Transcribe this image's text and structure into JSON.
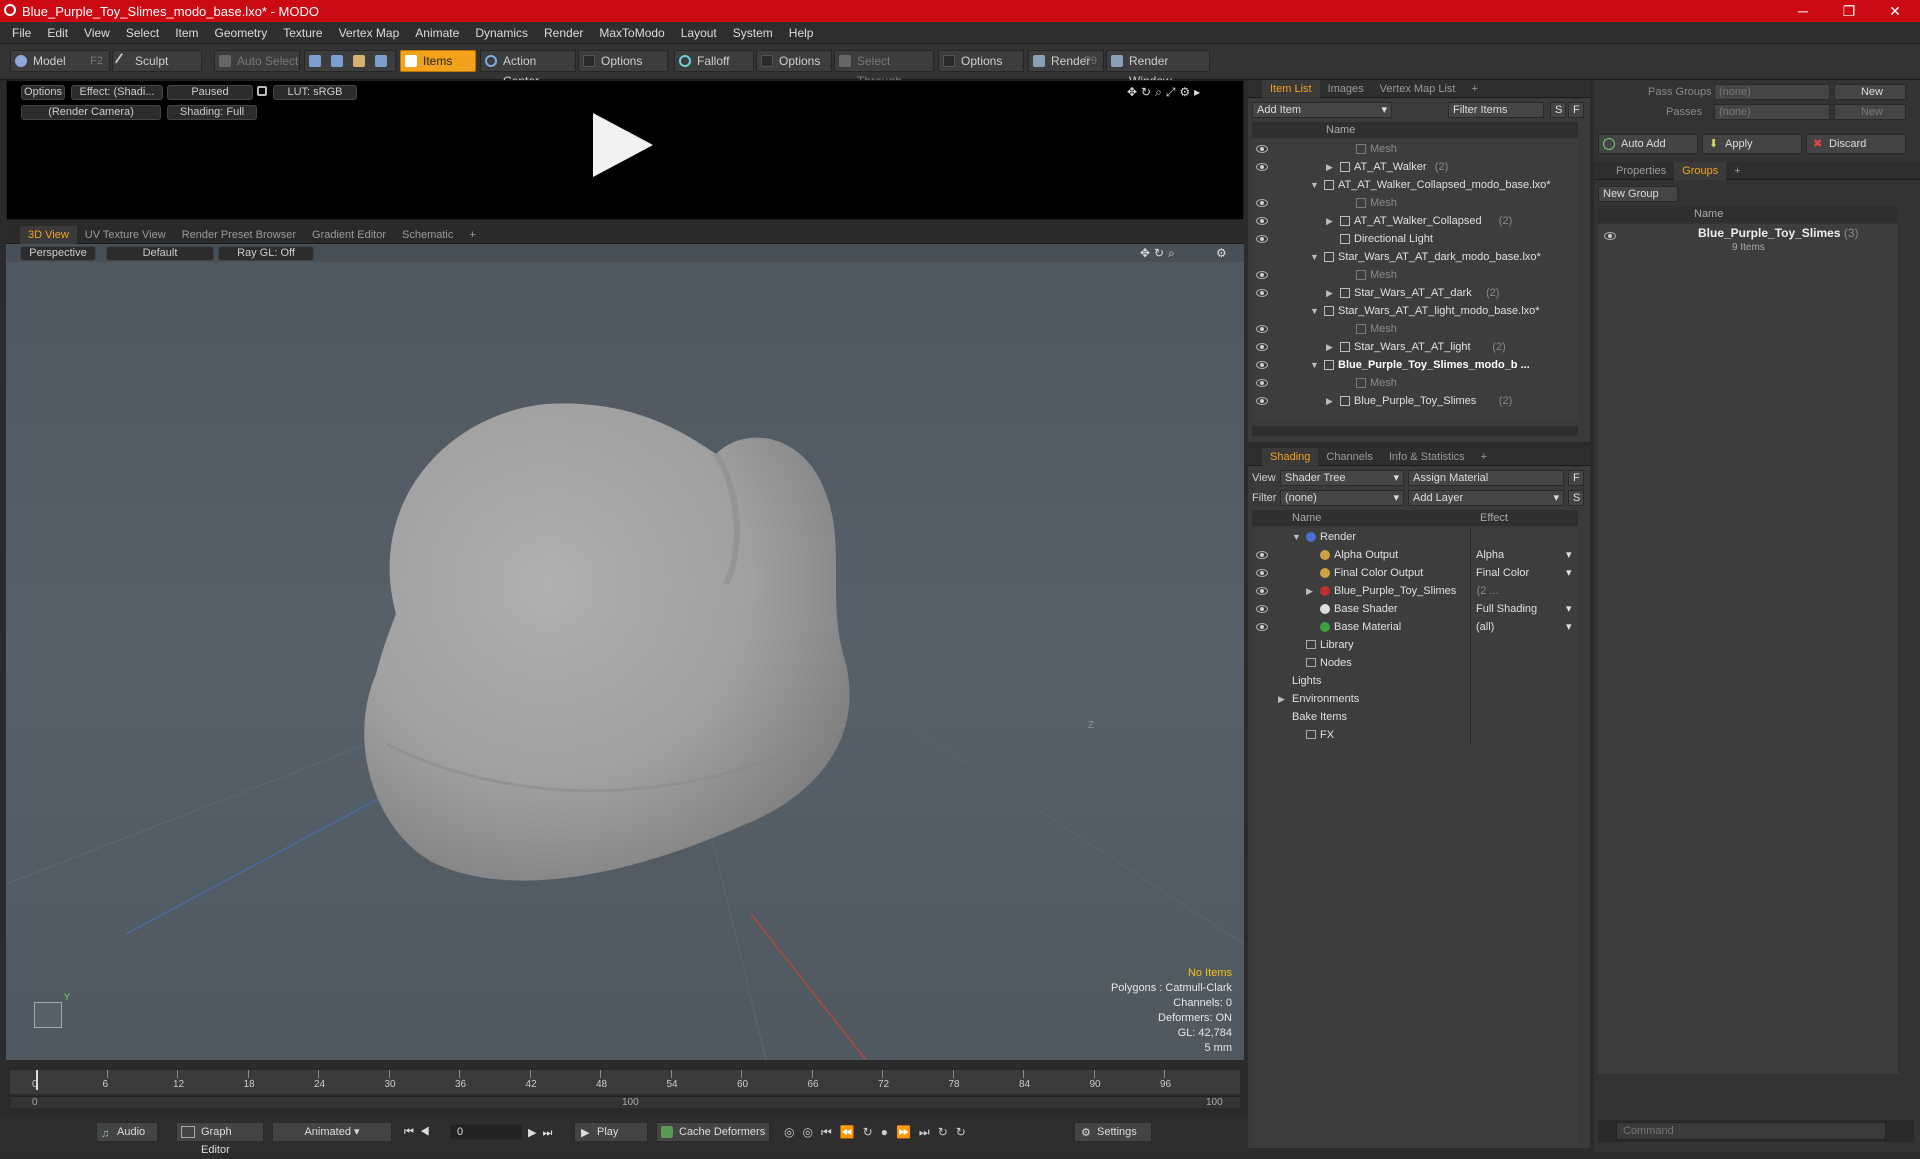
{
  "window": {
    "title": "Blue_Purple_Toy_Slimes_modo_base.lxo* - MODO",
    "min": "─",
    "max": "❐",
    "close": "✕"
  },
  "menu": [
    "File",
    "Edit",
    "View",
    "Select",
    "Item",
    "Geometry",
    "Texture",
    "Vertex Map",
    "Animate",
    "Dynamics",
    "Render",
    "MaxToModo",
    "Layout",
    "System",
    "Help"
  ],
  "toolbar": {
    "model": "Model",
    "model_key": "F2",
    "sculpt": "Sculpt",
    "auto_select": "Auto Select",
    "items": "Items",
    "action_center": "Action Center",
    "options1": "Options",
    "falloff": "Falloff",
    "options2": "Options",
    "select_through": "Select Through",
    "options3": "Options",
    "render": "Render",
    "render_key": "F9",
    "render_window": "Render Window"
  },
  "preview": {
    "options": "Options",
    "effect": "Effect: (Shadi...",
    "paused": "Paused",
    "lut": "LUT: sRGB",
    "camera": "(Render Camera)",
    "shading": "Shading: Full"
  },
  "view_tabs": [
    "3D View",
    "UV Texture View",
    "Render Preset Browser",
    "Gradient Editor",
    "Schematic",
    "+"
  ],
  "viewport": {
    "perspective": "Perspective",
    "default": "Default",
    "raygl": "Ray GL: Off",
    "axis_z": "Z",
    "axis_y": "Y",
    "info": {
      "items": "No Items",
      "polygons": "Polygons : Catmull-Clark",
      "channels": "Channels: 0",
      "deformers": "Deformers: ON",
      "gl": "GL: 42,784",
      "size": "5 mm"
    }
  },
  "timeline": {
    "ticks": [
      "0",
      "6",
      "12",
      "18",
      "24",
      "30",
      "36",
      "42",
      "48",
      "54",
      "60",
      "66",
      "72",
      "78",
      "84",
      "90",
      "96"
    ],
    "range_start": "0",
    "range_mid": "100",
    "range_end": "100"
  },
  "transport": {
    "audio": "Audio",
    "graph_editor": "Graph Editor",
    "animated": "Animated",
    "frame": "0",
    "play": "Play",
    "cache": "Cache Deformers",
    "settings": "Settings"
  },
  "item_list": {
    "tabs": [
      "Item List",
      "Images",
      "Vertex Map List",
      "+"
    ],
    "add_item": "Add Item",
    "filter": "Filter Items",
    "s": "S",
    "f": "F",
    "col_name": "Name",
    "rows": [
      {
        "label": "Mesh",
        "indent": 5,
        "gray": true,
        "eye": true
      },
      {
        "label": "AT_AT_Walker",
        "count": "(2)",
        "indent": 4,
        "expand": "▶",
        "eye": true
      },
      {
        "label": "AT_AT_Walker_Collapsed_modo_base.lxo*",
        "indent": 3,
        "expand": "▼",
        "eye": false
      },
      {
        "label": "Mesh",
        "indent": 5,
        "gray": true,
        "eye": true
      },
      {
        "label": "AT_AT_Walker_Collapsed",
        "count": "(2)",
        "indent": 4,
        "expand": "▶",
        "eye": true
      },
      {
        "label": "Directional Light",
        "indent": 4,
        "eye": true
      },
      {
        "label": "Star_Wars_AT_AT_dark_modo_base.lxo*",
        "indent": 3,
        "expand": "▼",
        "eye": false
      },
      {
        "label": "Mesh",
        "indent": 5,
        "gray": true,
        "eye": true
      },
      {
        "label": "Star_Wars_AT_AT_dark",
        "count": "(2)",
        "indent": 4,
        "expand": "▶",
        "eye": true
      },
      {
        "label": "Star_Wars_AT_AT_light_modo_base.lxo*",
        "indent": 3,
        "expand": "▼",
        "eye": false
      },
      {
        "label": "Mesh",
        "indent": 5,
        "gray": true,
        "eye": true
      },
      {
        "label": "Star_Wars_AT_AT_light",
        "count": "(2)",
        "indent": 4,
        "expand": "▶",
        "eye": true
      },
      {
        "label": "Blue_Purple_Toy_Slimes_modo_b ...",
        "indent": 3,
        "expand": "▼",
        "bold": true,
        "eye": true
      },
      {
        "label": "Mesh",
        "indent": 5,
        "gray": true,
        "eye": true
      },
      {
        "label": "Blue_Purple_Toy_Slimes",
        "count": "(2)",
        "indent": 4,
        "expand": "▶",
        "eye": true
      }
    ]
  },
  "shading": {
    "tabs": [
      "Shading",
      "Channels",
      "Info & Statistics",
      "+"
    ],
    "view_label": "View",
    "view_value": "Shader Tree",
    "assign": "Assign Material",
    "f": "F",
    "filter_label": "Filter",
    "filter_value": "(none)",
    "add_layer": "Add Layer",
    "s": "S",
    "col_name": "Name",
    "col_effect": "Effect",
    "rows": [
      {
        "label": "Render",
        "effect": "",
        "indent": 1,
        "expand": "▼",
        "eye": false,
        "icon": "#4a6fd0"
      },
      {
        "label": "Alpha Output",
        "effect": "Alpha",
        "indent": 2,
        "eye": true,
        "icon": "#d0a040"
      },
      {
        "label": "Final Color Output",
        "effect": "Final Color",
        "indent": 2,
        "eye": true,
        "icon": "#d0a040"
      },
      {
        "label": "Blue_Purple_Toy_Slimes",
        "count": "(2 ...",
        "effect": "",
        "indent": 2,
        "expand": "▶",
        "eye": true,
        "icon": "#c03030"
      },
      {
        "label": "Base Shader",
        "effect": "Full Shading",
        "indent": 2,
        "eye": true,
        "icon": "#dddddd"
      },
      {
        "label": "Base Material",
        "effect": "(all)",
        "indent": 2,
        "eye": true,
        "icon": "#3aa040"
      },
      {
        "label": "Library",
        "effect": "",
        "indent": 1,
        "eye": false
      },
      {
        "label": "Nodes",
        "effect": "",
        "indent": 1,
        "eye": false
      },
      {
        "label": "Lights",
        "effect": "",
        "indent": 0,
        "eye": false
      },
      {
        "label": "Environments",
        "effect": "",
        "indent": 0,
        "expand": "▶",
        "eye": false
      },
      {
        "label": "Bake Items",
        "effect": "",
        "indent": 0,
        "eye": false
      },
      {
        "label": "FX",
        "effect": "",
        "indent": 1,
        "eye": false
      }
    ]
  },
  "right": {
    "pass_groups": "Pass Groups",
    "pass_value": "(none)",
    "new1": "New",
    "passes": "Passes",
    "passes_value": "(none)",
    "new2": "New",
    "auto_add": "Auto Add",
    "apply": "Apply",
    "discard": "Discard",
    "tabs": [
      "Properties",
      "Groups",
      "+"
    ],
    "new_group": "New Group",
    "col_name": "Name",
    "group_name": "Blue_Purple_Toy_Slimes",
    "group_count": "(3)",
    "group_items": "9 Items",
    "command_placeholder": "Command"
  }
}
